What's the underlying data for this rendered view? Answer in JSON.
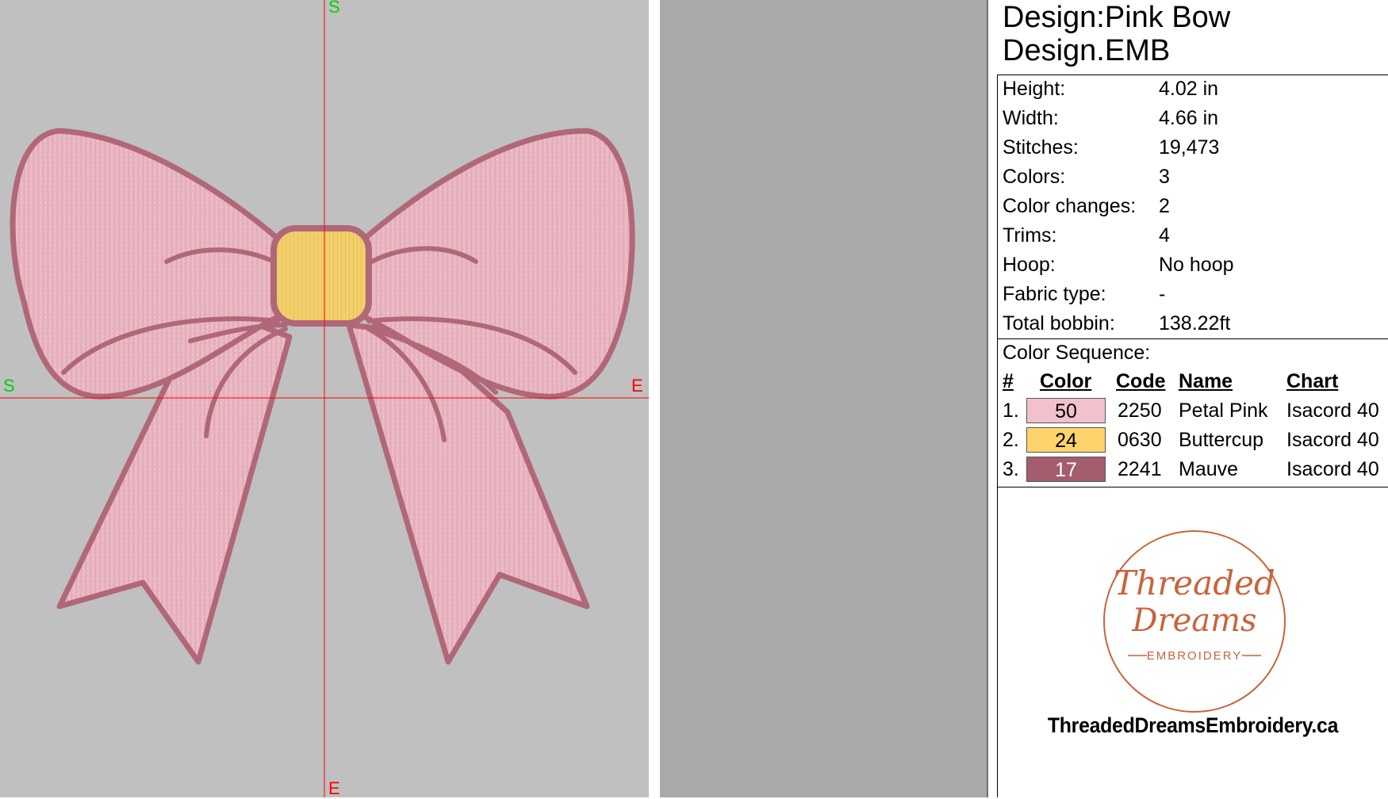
{
  "design": {
    "title": "Design:Pink Bow",
    "file": "Design.EMB"
  },
  "canvas": {
    "axis_labels": {
      "top": "S",
      "left": "S",
      "right": "E",
      "bottom": "E"
    },
    "colors": {
      "background": "#c0c0c0",
      "crosshair": "#ff0000",
      "bow_fill": "#e8b4c0",
      "bow_outline": "#b06878",
      "knot": "#f2cf6a"
    }
  },
  "properties": [
    {
      "label": "Height:",
      "value": "4.02 in"
    },
    {
      "label": "Width:",
      "value": "4.66 in"
    },
    {
      "label": "Stitches:",
      "value": "19,473"
    },
    {
      "label": "Colors:",
      "value": "3"
    },
    {
      "label": "Color changes:",
      "value": "2"
    },
    {
      "label": "Trims:",
      "value": "4"
    },
    {
      "label": "Hoop:",
      "value": "No hoop"
    },
    {
      "label": "Fabric type:",
      "value": "-"
    },
    {
      "label": "Total bobbin:",
      "value": "138.22ft"
    }
  ],
  "color_sequence": {
    "title": "Color Sequence:",
    "headers": {
      "num": "#",
      "color": "Color",
      "code": "Code",
      "name": "Name",
      "chart": "Chart"
    },
    "rows": [
      {
        "num": "1.",
        "swatch_label": "50",
        "swatch_color": "#f1c2cd",
        "code": "2250",
        "name": "Petal Pink",
        "chart": "Isacord 40"
      },
      {
        "num": "2.",
        "swatch_label": "24",
        "swatch_color": "#fdd46c",
        "code": "0630",
        "name": "Buttercup",
        "chart": "Isacord 40"
      },
      {
        "num": "3.",
        "swatch_label": "17",
        "swatch_color": "#a35d6d",
        "code": "2241",
        "name": "Mauve",
        "chart": "Isacord 40"
      }
    ]
  },
  "logo": {
    "line1": "Threaded",
    "line2": "Dreams",
    "line3": "EMBROIDERY",
    "color": "#c8643c"
  },
  "website": "ThreadedDreamsEmbroidery.ca"
}
